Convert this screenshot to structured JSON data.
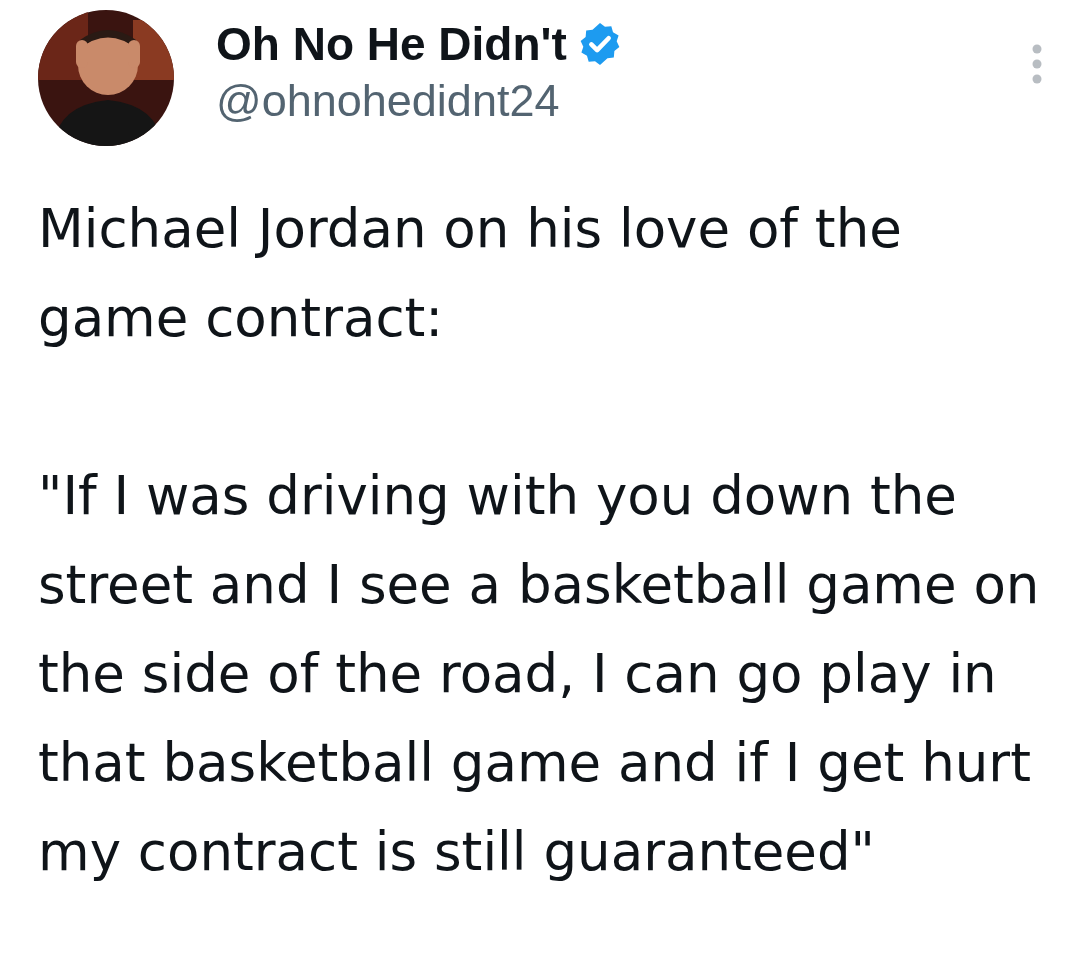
{
  "author": {
    "name": "Oh No He Didn't",
    "verified": true,
    "handle": "@ohnohedidnt24"
  },
  "tweet": {
    "paragraphs": [
      "Michael Jordan on his love of the game contract:",
      "\"If I was driving with you down the street and I see a basketball game on the side of the road, I can go play in that basketball game and if I get hurt my contract is still guaranteed\""
    ]
  }
}
